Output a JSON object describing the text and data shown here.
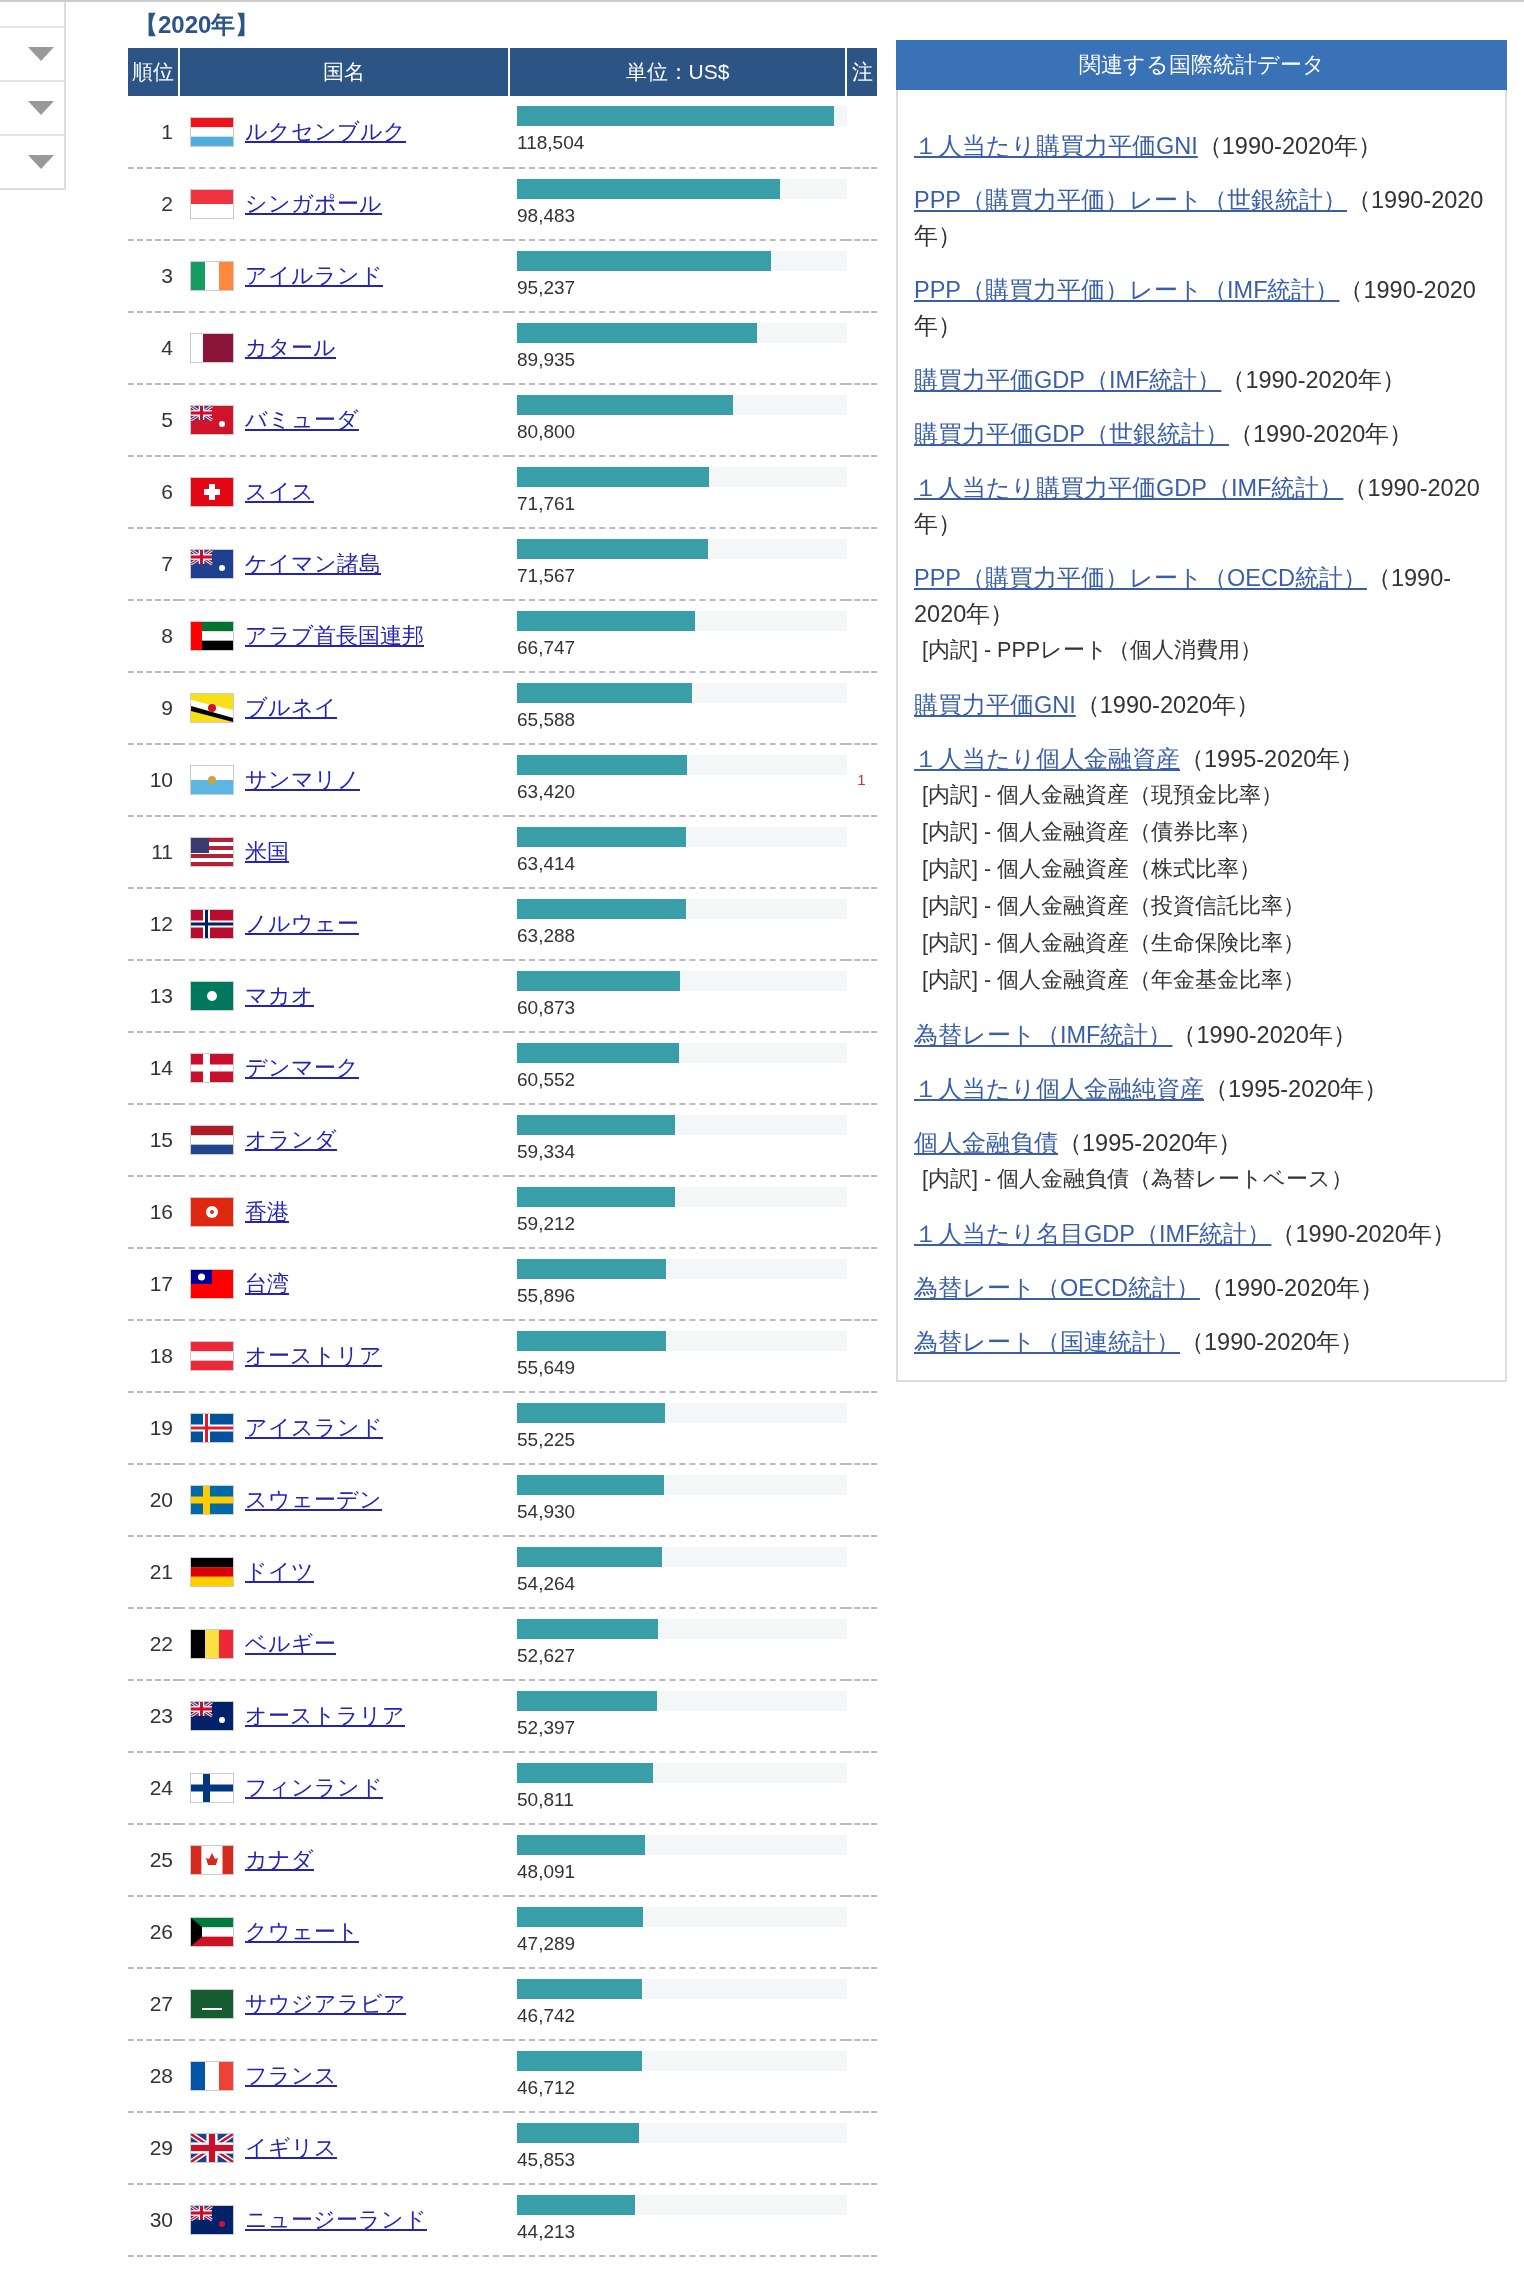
{
  "year_heading": "【2020年】",
  "table": {
    "columns": [
      "順位",
      "国名",
      "単位：US$",
      "注"
    ],
    "rows": [
      {
        "rank": "1",
        "country": "ルクセンブルク",
        "value": "118,504",
        "level": 0.96
      },
      {
        "rank": "2",
        "country": "シンガポール",
        "value": "98,483",
        "level": 0.797
      },
      {
        "rank": "3",
        "country": "アイルランド",
        "value": "95,237",
        "level": 0.771
      },
      {
        "rank": "4",
        "country": "カタール",
        "value": "89,935",
        "level": 0.728
      },
      {
        "rank": "5",
        "country": "バミューダ",
        "value": "80,800",
        "level": 0.654
      },
      {
        "rank": "6",
        "country": "スイス",
        "value": "71,761",
        "level": 0.581
      },
      {
        "rank": "7",
        "country": "ケイマン諸島",
        "value": "71,567",
        "level": 0.579
      },
      {
        "rank": "8",
        "country": "アラブ首長国連邦",
        "value": "66,747",
        "level": 0.54
      },
      {
        "rank": "9",
        "country": "ブルネイ",
        "value": "65,588",
        "level": 0.531
      },
      {
        "rank": "10",
        "country": "サンマリノ",
        "value": "63,420",
        "level": 0.514,
        "note": "1"
      },
      {
        "rank": "11",
        "country": "米国",
        "value": "63,414",
        "level": 0.513
      },
      {
        "rank": "12",
        "country": "ノルウェー",
        "value": "63,288",
        "level": 0.512
      },
      {
        "rank": "13",
        "country": "マカオ",
        "value": "60,873",
        "level": 0.493
      },
      {
        "rank": "14",
        "country": "デンマーク",
        "value": "60,552",
        "level": 0.49
      },
      {
        "rank": "15",
        "country": "オランダ",
        "value": "59,334",
        "level": 0.48
      },
      {
        "rank": "16",
        "country": "香港",
        "value": "59,212",
        "level": 0.479
      },
      {
        "rank": "17",
        "country": "台湾",
        "value": "55,896",
        "level": 0.453
      },
      {
        "rank": "18",
        "country": "オーストリア",
        "value": "55,649",
        "level": 0.451
      },
      {
        "rank": "19",
        "country": "アイスランド",
        "value": "55,225",
        "level": 0.447
      },
      {
        "rank": "20",
        "country": "スウェーデン",
        "value": "54,930",
        "level": 0.445
      },
      {
        "rank": "21",
        "country": "ドイツ",
        "value": "54,264",
        "level": 0.439
      },
      {
        "rank": "22",
        "country": "ベルギー",
        "value": "52,627",
        "level": 0.426
      },
      {
        "rank": "23",
        "country": "オーストラリア",
        "value": "52,397",
        "level": 0.424
      },
      {
        "rank": "24",
        "country": "フィンランド",
        "value": "50,811",
        "level": 0.411
      },
      {
        "rank": "25",
        "country": "カナダ",
        "value": "48,091",
        "level": 0.389
      },
      {
        "rank": "26",
        "country": "クウェート",
        "value": "47,289",
        "level": 0.383
      },
      {
        "rank": "27",
        "country": "サウジアラビア",
        "value": "46,742",
        "level": 0.378
      },
      {
        "rank": "28",
        "country": "フランス",
        "value": "46,712",
        "level": 0.378
      },
      {
        "rank": "29",
        "country": "イギリス",
        "value": "45,853",
        "level": 0.371
      },
      {
        "rank": "30",
        "country": "ニュージーランド",
        "value": "44,213",
        "level": 0.358
      }
    ]
  },
  "related": {
    "title": "関連する国際統計データ",
    "items": [
      {
        "kind": "link",
        "link": "１人当たり購買力平価GNI",
        "period": "（1990-2020年）"
      },
      {
        "kind": "link",
        "link": "PPP（購買力平価）レート（世銀統計）",
        "period": "（1990-2020年）"
      },
      {
        "kind": "link",
        "link": "PPP（購買力平価）レート（IMF統計）",
        "period": "（1990-2020年）"
      },
      {
        "kind": "link",
        "link": "購買力平価GDP（IMF統計）",
        "period": "（1990-2020年）"
      },
      {
        "kind": "link",
        "link": "購買力平価GDP（世銀統計）",
        "period": "（1990-2020年）"
      },
      {
        "kind": "link",
        "link": "１人当たり購買力平価GDP（IMF統計）",
        "period": "（1990-2020年）"
      },
      {
        "kind": "link",
        "link": "PPP（購買力平価）レート（OECD統計）",
        "period": "（1990-2020年）"
      },
      {
        "kind": "sub",
        "text": "[内訳] - PPPレート（個人消費用）"
      },
      {
        "kind": "link",
        "link": "購買力平価GNI",
        "period": "（1990-2020年）"
      },
      {
        "kind": "link",
        "link": "１人当たり個人金融資産",
        "period": "（1995-2020年）"
      },
      {
        "kind": "sub",
        "text": "[内訳] - 個人金融資産（現預金比率）"
      },
      {
        "kind": "sub",
        "text": "[内訳] - 個人金融資産（債券比率）"
      },
      {
        "kind": "sub",
        "text": "[内訳] - 個人金融資産（株式比率）"
      },
      {
        "kind": "sub",
        "text": "[内訳] - 個人金融資産（投資信託比率）"
      },
      {
        "kind": "sub",
        "text": "[内訳] - 個人金融資産（生命保険比率）"
      },
      {
        "kind": "sub",
        "text": "[内訳] - 個人金融資産（年金基金比率）"
      },
      {
        "kind": "link",
        "link": "為替レート（IMF統計）",
        "period": "（1990-2020年）"
      },
      {
        "kind": "link",
        "link": "１人当たり個人金融純資産",
        "period": "（1995-2020年）"
      },
      {
        "kind": "link",
        "link": "個人金融負債",
        "period": "（1995-2020年）"
      },
      {
        "kind": "sub",
        "text": "[内訳] - 個人金融負債（為替レートベース）"
      },
      {
        "kind": "link",
        "link": "１人当たり名目GDP（IMF統計）",
        "period": "（1990-2020年）"
      },
      {
        "kind": "link",
        "link": "為替レート（OECD統計）",
        "period": "（1990-2020年）"
      },
      {
        "kind": "link",
        "link": "為替レート（国連統計）",
        "period": "（1990-2020年）"
      }
    ]
  }
}
